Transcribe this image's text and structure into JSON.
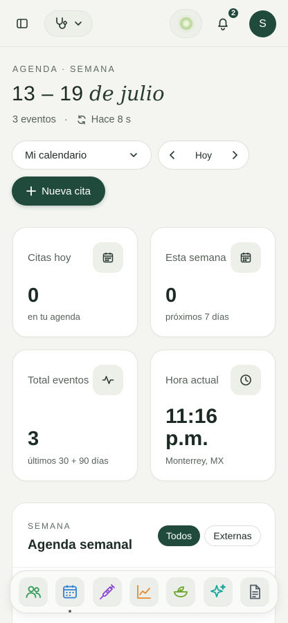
{
  "header": {
    "notifications_count": "2",
    "avatar_initial": "S"
  },
  "agenda": {
    "eyebrow": "AGENDA · SEMANA",
    "date_range": "13 – 19",
    "month": "de julio",
    "event_count": "3 eventos",
    "separator": "·",
    "sync_status": "Hace 8 s"
  },
  "controls": {
    "calendar_select": "Mi calendario",
    "today_label": "Hoy",
    "new_appointment": "Nueva cita"
  },
  "stats": [
    {
      "label": "Citas hoy",
      "value": "0",
      "sub": "en tu agenda",
      "icon": "calendar-icon"
    },
    {
      "label": "Esta semana",
      "value": "0",
      "sub": "próximos 7 días",
      "icon": "calendar-icon"
    },
    {
      "label": "Total eventos",
      "value": "3",
      "sub": "últimos 30 + 90 días",
      "icon": "activity-icon"
    },
    {
      "label": "Hora actual",
      "value_line1": "11:16",
      "value_line2": "p.m.",
      "sub": "Monterrey, MX",
      "icon": "clock-icon"
    }
  ],
  "week": {
    "eyebrow": "SEMANA",
    "title": "Agenda semanal",
    "filter_all": "Todos",
    "filter_external": "Externas"
  },
  "dock": {
    "items": [
      "patients-icon",
      "calendar-icon",
      "syringe-icon",
      "chart-icon",
      "nutrition-icon",
      "sparkle-icon",
      "document-icon"
    ],
    "colors": {
      "green": "#2f9a55",
      "blue": "#2f7fd6",
      "purple": "#8b46d8",
      "orange": "#e48a2c",
      "lime": "#6aa52a",
      "teal": "#17a89a",
      "slate": "#55606b"
    }
  },
  "colors": {
    "accent": "#1f4a3c",
    "background": "#f4f5f1"
  }
}
